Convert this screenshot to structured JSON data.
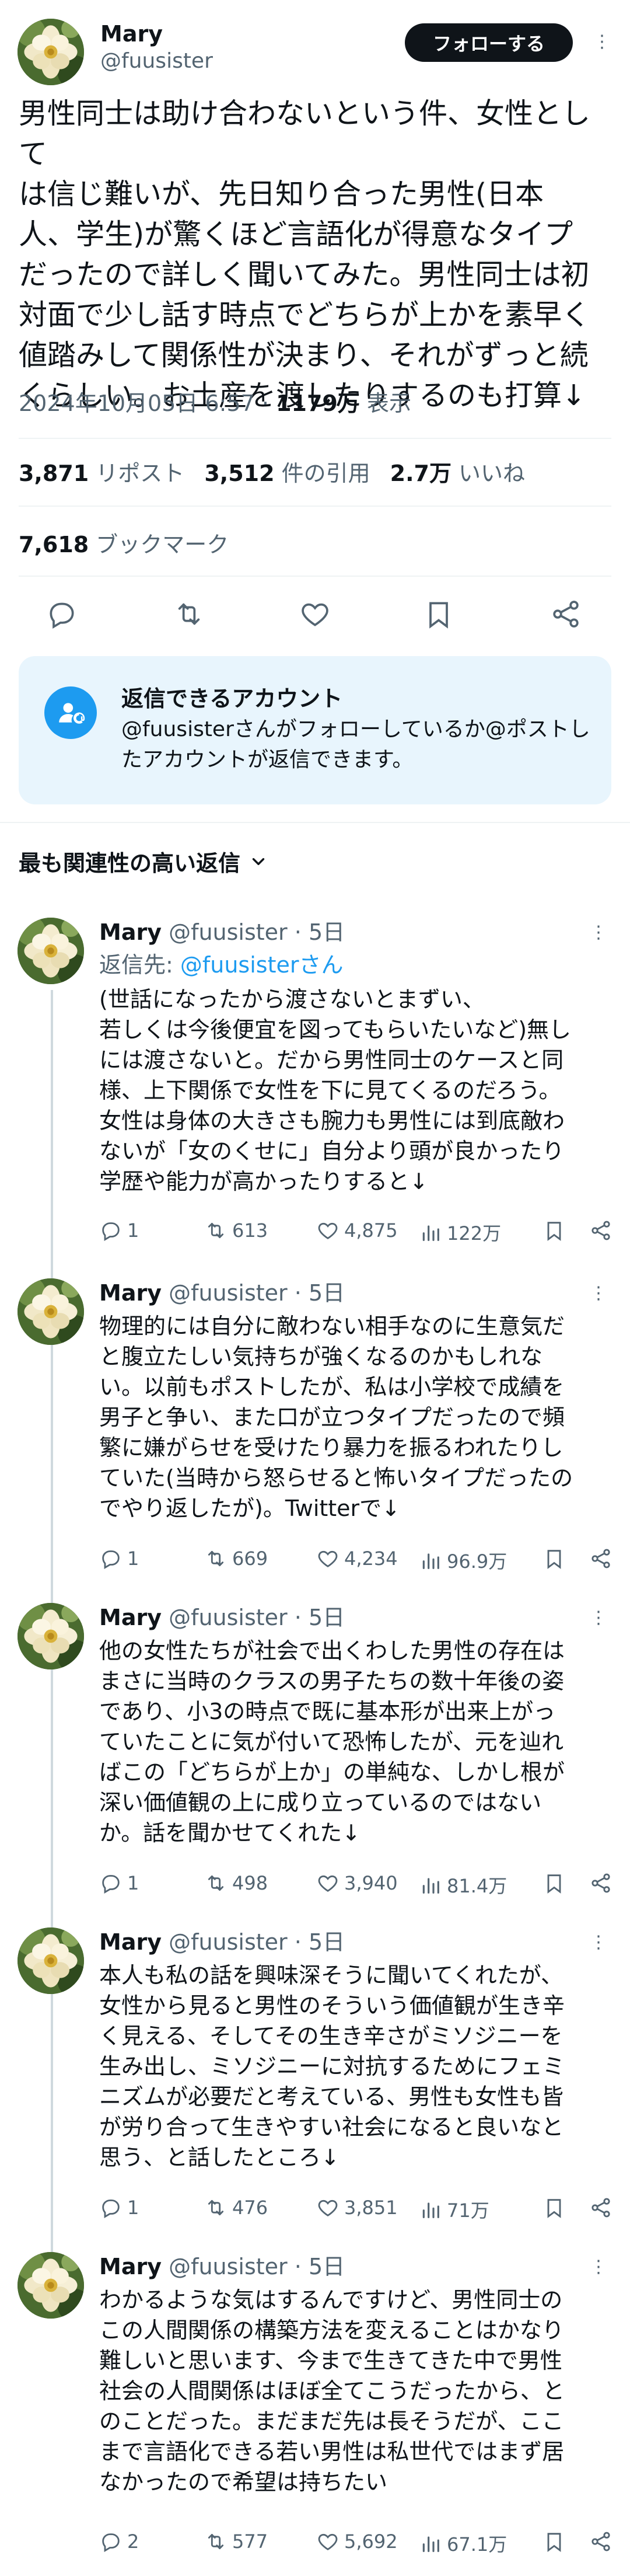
{
  "author": {
    "name": "Mary",
    "handle": "@fuusister"
  },
  "header": {
    "follow_label": "フォローする"
  },
  "main_post": {
    "text": "男性同士は助け合わないという件、女性として\nは信じ難いが、先日知り合った男性(日本\n人、学生)が驚くほど言語化が得意なタイプ\nだったので詳しく聞いてみた。男性同士は初\n対面で少し話す時点でどちらが上かを素早く\n値踏みして関係性が決まり、それがずっと続\nくらしい。お土産を渡したりするのも打算↓",
    "datetime": "2024年10月05日 6:57",
    "views_count": "1179万",
    "views_label": "表示"
  },
  "stats": {
    "reposts_count": "3,871",
    "reposts_label": "リポスト",
    "quotes_count": "3,512",
    "quotes_label": "件の引用",
    "likes_count": "2.7万",
    "likes_label": "いいね",
    "bookmarks_count": "7,618",
    "bookmarks_label": "ブックマーク"
  },
  "actions": {
    "icons": [
      "reply-icon",
      "repost-icon",
      "like-icon",
      "bookmark-icon",
      "share-icon"
    ]
  },
  "reply_restriction": {
    "title": "返信できるアカウント",
    "description": "@fuusisterさんがフォローしているか@ポストしたアカウントが返信できます。"
  },
  "replies_section": {
    "title": "最も関連性の高い返信"
  },
  "replies": [
    {
      "name": "Mary",
      "handle": "@fuusister",
      "time": "5日",
      "reply_to_label": "返信先: ",
      "reply_to_handle": "@fuusisterさん",
      "text": "(世話になったから渡さないとまずい、\n若しくは今後便宜を図ってもらいたいなど)無し\nには渡さないと。だから男性同士のケースと同\n様、上下関係で女性を下に見てくるのだろう。\n女性は身体の大きさも腕力も男性には到底敵わ\nないが「女のくせに」自分より頭が良かったり\n学歴や能力が高かったりすると↓",
      "replies": "1",
      "reposts": "613",
      "likes": "4,875",
      "views": "122万"
    },
    {
      "name": "Mary",
      "handle": "@fuusister",
      "time": "5日",
      "text": "物理的には自分に敵わない相手なのに生意気だ\nと腹立たしい気持ちが強くなるのかもしれな\nい。以前もポストしたが、私は小学校で成績を\n男子と争い、また口が立つタイプだったので頻\n繁に嫌がらせを受けたり暴力を振るわれたりし\nていた(当時から怒らせると怖いタイプだったの\nでやり返したが)。Twitterで↓",
      "replies": "1",
      "reposts": "669",
      "likes": "4,234",
      "views": "96.9万"
    },
    {
      "name": "Mary",
      "handle": "@fuusister",
      "time": "5日",
      "text": "他の女性たちが社会で出くわした男性の存在は\nまさに当時のクラスの男子たちの数十年後の姿\nであり、小3の時点で既に基本形が出来上がっ\nていたことに気が付いて恐怖したが、元を辿れ\nばこの「どちらが上か」の単純な、しかし根が\n深い価値観の上に成り立っているのではない\nか。話を聞かせてくれた↓",
      "replies": "1",
      "reposts": "498",
      "likes": "3,940",
      "views": "81.4万"
    },
    {
      "name": "Mary",
      "handle": "@fuusister",
      "time": "5日",
      "text": "本人も私の話を興味深そうに聞いてくれたが、\n女性から見ると男性のそういう価値観が生き辛\nく見える、そしてその生き辛さがミソジニーを\n生み出し、ミソジニーに対抗するためにフェミ\nニズムが必要だと考えている、男性も女性も皆\nが労り合って生きやすい社会になると良いなと\n思う、と話したところ↓",
      "replies": "1",
      "reposts": "476",
      "likes": "3,851",
      "views": "71万"
    },
    {
      "name": "Mary",
      "handle": "@fuusister",
      "time": "5日",
      "text": "わかるような気はするんですけど、男性同士の\nこの人間関係の構築方法を変えることはかなり\n難しいと思います、今まで生きてきた中で男性\n社会の人間関係はほぼ全てこうだったから、と\nのことだった。まだまだ先は長そうだが、ここ\nまで言語化できる若い男性は私世代ではまず居\nなかったので希望は持ちたい",
      "replies": "2",
      "reposts": "577",
      "likes": "5,692",
      "views": "67.1万"
    }
  ],
  "colors": {
    "accent": "#1d9bf0",
    "text": "#0f1419",
    "muted": "#536471",
    "reply_box_bg": "#e8f5fd"
  }
}
